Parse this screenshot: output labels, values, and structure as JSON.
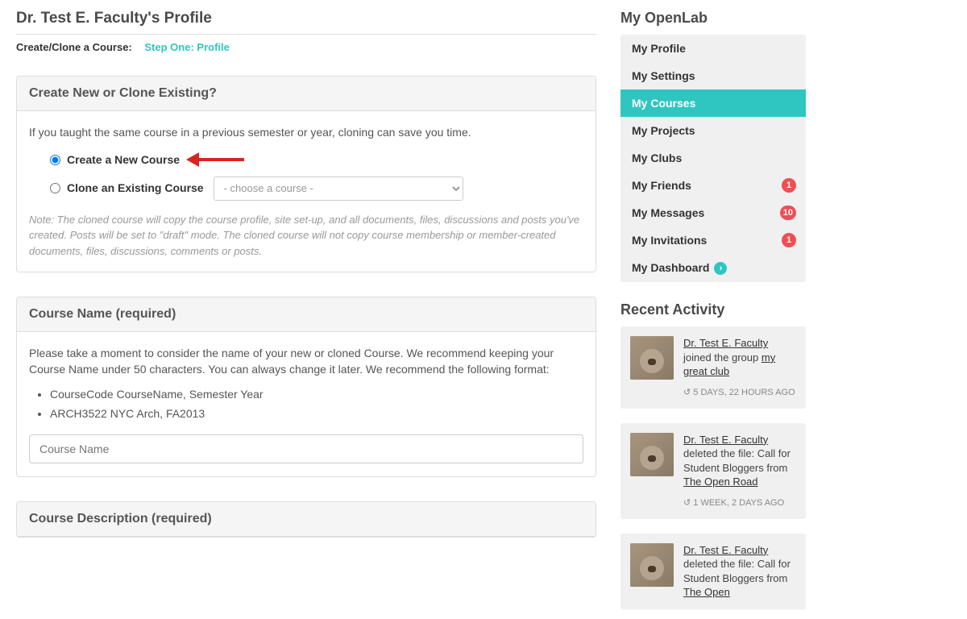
{
  "page_title": "Dr. Test E. Faculty's Profile",
  "breadcrumb": {
    "label": "Create/Clone a Course:",
    "step": "Step One: Profile"
  },
  "panel_create": {
    "heading": "Create New or Clone Existing?",
    "intro": "If you taught the same course in a previous semester or year, cloning can save you time.",
    "radio_create": "Create a New Course",
    "radio_clone": "Clone an Existing Course",
    "select_placeholder": "- choose a course -",
    "note": "Note: The cloned course will copy the course profile, site set-up, and all documents, files, discussions and posts you've created. Posts will be set to \"draft\" mode. The cloned course will not copy course membership or member-created documents, files, discussions, comments or posts."
  },
  "panel_name": {
    "heading": "Course Name (required)",
    "intro": "Please take a moment to consider the name of your new or cloned Course. We recommend keeping your Course Name under 50 characters. You can always change it later. We recommend the following format:",
    "bullets": [
      "CourseCode CourseName, Semester Year",
      "ARCH3522 NYC Arch, FA2013"
    ],
    "placeholder": "Course Name"
  },
  "panel_desc": {
    "heading": "Course Description (required)"
  },
  "sidebar": {
    "title": "My OpenLab",
    "items": [
      {
        "label": "My Profile"
      },
      {
        "label": "My Settings"
      },
      {
        "label": "My Courses",
        "active": true
      },
      {
        "label": "My Projects"
      },
      {
        "label": "My Clubs"
      },
      {
        "label": "My Friends",
        "badge": "1"
      },
      {
        "label": "My Messages",
        "badge": "10"
      },
      {
        "label": "My Invitations",
        "badge": "1"
      },
      {
        "label": "My Dashboard",
        "chevron": true
      }
    ]
  },
  "activity": {
    "title": "Recent Activity",
    "items": [
      {
        "user": "Dr. Test E. Faculty",
        "action_prefix": " joined the group ",
        "target": "my great club",
        "time": "5 DAYS, 22 HOURS AGO"
      },
      {
        "user": "Dr. Test E. Faculty",
        "action_prefix": " deleted the file: Call for Student Bloggers from ",
        "target": "The Open Road",
        "time": "1 WEEK, 2 DAYS AGO"
      },
      {
        "user": "Dr. Test E. Faculty",
        "action_prefix": " deleted the file: Call for Student Bloggers from ",
        "target": "The Open",
        "time": ""
      }
    ]
  }
}
